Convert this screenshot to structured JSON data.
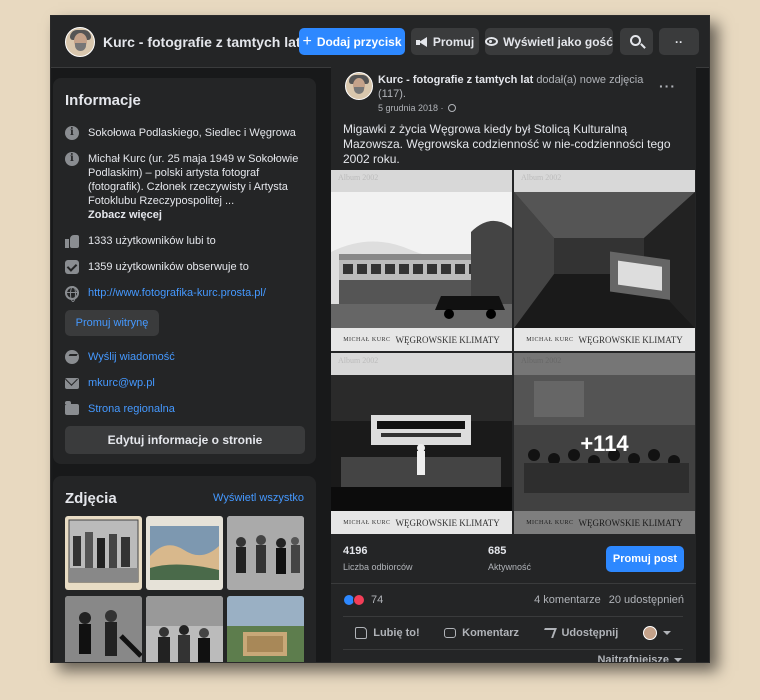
{
  "topbar": {
    "page_name": "Kurc - fotografie z tamtych lat",
    "add_button": "Dodaj przycisk",
    "promote": "Promuj",
    "view_as_guest": "Wyświetl jako gość",
    "more": "··"
  },
  "info": {
    "title": "Informacje",
    "location": "Sokołowa Podlaskiego, Siedlec i Węgrowa",
    "bio": "Michał Kurc (ur. 25 maja 1949 w Sokołowie Podlaskim) – polski artysta fotograf (fotografik). Członek rzeczywisty i Artysta Fotoklubu Rzeczypospolitej ...",
    "see_more": "Zobacz więcej",
    "likes": "1333 użytkowników lubi to",
    "followers": "1359 użytkowników obserwuje to",
    "website": "http://www.fotografika-kurc.prosta.pl/",
    "promote_site": "Promuj witrynę",
    "message": "Wyślij wiadomość",
    "email": "mkurc@wp.pl",
    "category": "Strona regionalna",
    "edit": "Edytuj informacje o stronie"
  },
  "photos": {
    "title": "Zdjęcia",
    "see_all": "Wyświetl wszystko"
  },
  "post": {
    "author": "Kurc - fotografie z tamtych lat",
    "action": "dodał(a) nowe zdjęcia (117).",
    "date": "5 grudnia 2018 ·",
    "text": "Migawki z życia Węgrowa kiedy był Stolicą Kulturalną Mazowsza. Węgrowska codzienność w nie-codzienności tego 2002 roku.",
    "photo_album_label": "Album 2002",
    "photo_caption_small": "MICHAŁ KURC",
    "photo_caption_big": "WĘGROWSKIE KLIMATY",
    "more_count": "+114",
    "reach_value": "4196",
    "reach_label": "Liczba odbiorców",
    "engagement_value": "685",
    "engagement_label": "Aktywność",
    "promote_post": "Promuj post",
    "reaction_count": "74",
    "comments": "4 komentarze",
    "shares": "20 udostępnień",
    "like": "Lubię to!",
    "comment": "Komentarz",
    "share": "Udostępnij",
    "sort": "Najtrafniejsze"
  },
  "colors": {
    "background": "#18191a",
    "card": "#242526",
    "accent": "#2d88ff",
    "link": "#4599ff"
  }
}
